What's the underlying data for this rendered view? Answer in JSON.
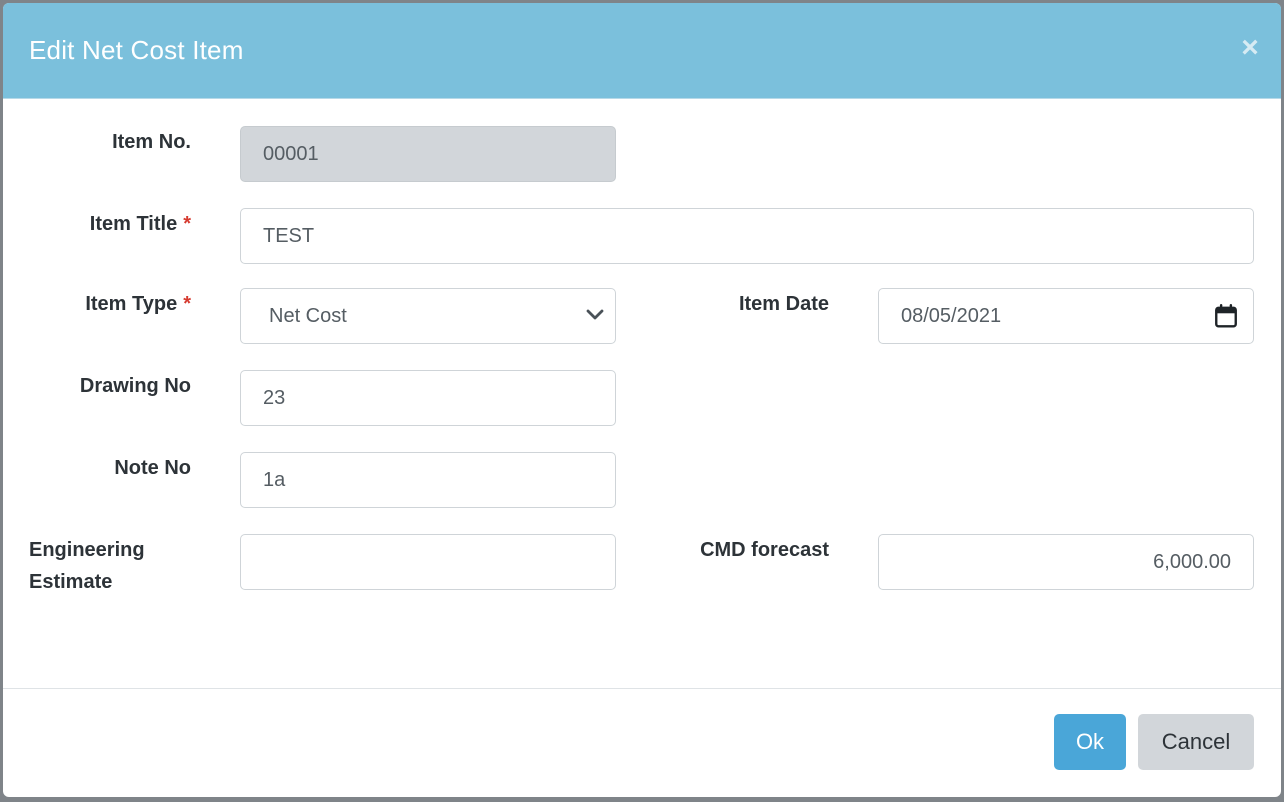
{
  "dialog": {
    "title": "Edit Net Cost Item",
    "close_glyph": "×"
  },
  "form": {
    "item_no": {
      "label": "Item No.",
      "value": "00001"
    },
    "item_title": {
      "label": "Item Title",
      "required_mark": "*",
      "value": "TEST"
    },
    "item_type": {
      "label": "Item Type",
      "required_mark": "*",
      "value": "Net Cost"
    },
    "item_date": {
      "label": "Item Date",
      "value": "08/05/2021"
    },
    "drawing_no": {
      "label": "Drawing No",
      "value": "23"
    },
    "note_no": {
      "label": "Note No",
      "value": "1a"
    },
    "engineering_estimate": {
      "label_line1": "Engineering",
      "label_line2": "Estimate",
      "value": ""
    },
    "cmd_forecast": {
      "label": "CMD forecast",
      "value": "6,000.00"
    }
  },
  "footer": {
    "ok_label": "Ok",
    "cancel_label": "Cancel"
  },
  "colors": {
    "header_bg": "#7bc0dc",
    "ok_bg": "#4aa6d8",
    "cancel_bg": "#d2d6da",
    "required": "#d63a2f"
  },
  "icons": {
    "close": "close-icon",
    "select_caret": "chevron-down-icon",
    "date_picker": "calendar-icon"
  }
}
